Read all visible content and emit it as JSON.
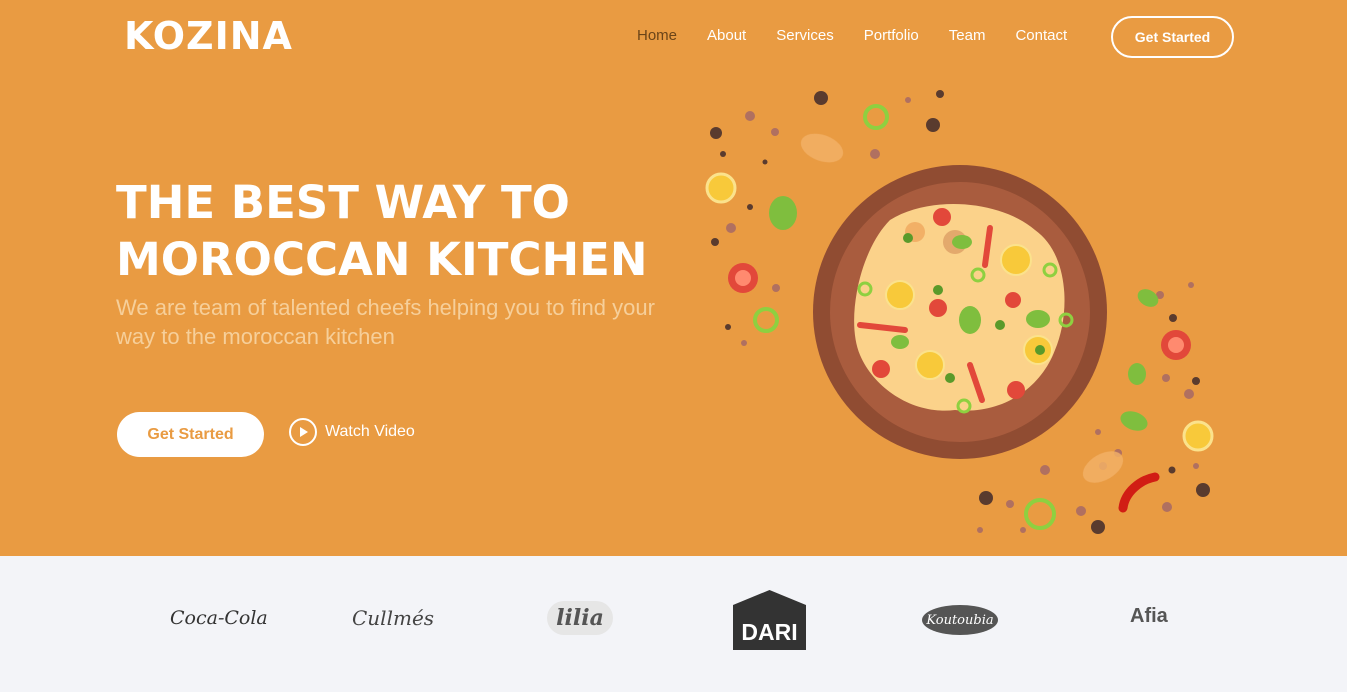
{
  "brand": {
    "logo": "KOZINA"
  },
  "nav": {
    "items": [
      {
        "label": "Home",
        "active": true
      },
      {
        "label": "About",
        "active": false
      },
      {
        "label": "Services",
        "active": false
      },
      {
        "label": "Portfolio",
        "active": false
      },
      {
        "label": "Team",
        "active": false
      },
      {
        "label": "Contact",
        "active": false
      }
    ],
    "cta": "Get Started"
  },
  "hero": {
    "title_line1": "THE BEST WAY TO",
    "title_line2": "MOROCCAN KITCHEN",
    "subtitle": "We are team of talented cheefs helping you to find your way to the moroccan kitchen",
    "primary_button": "Get Started",
    "video_button": "Watch Video",
    "illustration": "moroccan-dish-plate-illustration"
  },
  "clients": {
    "logos": [
      "Coca-Cola",
      "Cullmés",
      "lilia",
      "DARI",
      "Koutoubia",
      "Afia"
    ]
  },
  "colors": {
    "hero_bg": "#e99b42",
    "active_nav": "#6b4418",
    "clients_bg": "#f3f4f8",
    "white": "#ffffff"
  }
}
